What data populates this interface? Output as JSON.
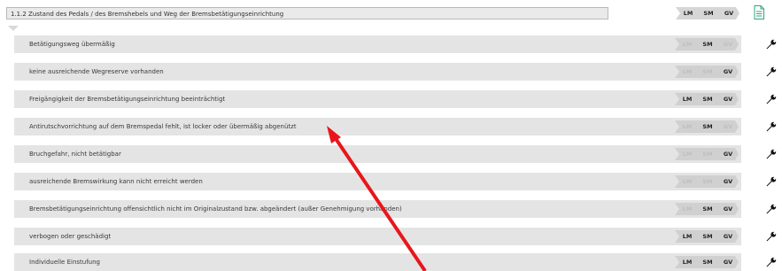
{
  "header": {
    "title": "1.1.2 Zustand des Pedals / des Bremshebels und Weg der Bremsbetätigungseinrichtung",
    "badges": {
      "lm": "LM",
      "sm": "SM",
      "gv": "GV"
    }
  },
  "icons": {
    "document": "document-icon",
    "wrench": "wrench-icon",
    "annotation": "red-arrow"
  },
  "colors": {
    "accent_green": "#2fa57b",
    "arrow_red": "#e8161b",
    "row_bg": "#e4e4e4"
  },
  "rows": [
    {
      "label": "Betätigungsweg übermäßig",
      "lm": "LM",
      "sm": "SM",
      "gv": "GV",
      "lm_on": false,
      "sm_on": true,
      "gv_on": false
    },
    {
      "label": "keine ausreichende Wegreserve vorhanden",
      "lm": "LM",
      "sm": "SM",
      "gv": "GV",
      "lm_on": false,
      "sm_on": false,
      "gv_on": true
    },
    {
      "label": "Freigängigkeit der Bremsbetätigungseinrichtung beeinträchtigt",
      "lm": "LM",
      "sm": "SM",
      "gv": "GV",
      "lm_on": true,
      "sm_on": true,
      "gv_on": true
    },
    {
      "label": "Antirutschvorrichtung auf dem Bremspedal fehlt, ist locker oder übermäßig abgenützt",
      "lm": "LM",
      "sm": "SM",
      "gv": "GV",
      "lm_on": false,
      "sm_on": true,
      "gv_on": false
    },
    {
      "label": "Bruchgefahr, nicht betätigbar",
      "lm": "LM",
      "sm": "SM",
      "gv": "GV",
      "lm_on": false,
      "sm_on": false,
      "gv_on": true
    },
    {
      "label": "ausreichende Bremswirkung kann nicht erreicht werden",
      "lm": "LM",
      "sm": "SM",
      "gv": "GV",
      "lm_on": false,
      "sm_on": false,
      "gv_on": true
    },
    {
      "label": "Bremsbetätigungseinrichtung offensichtlich nicht im Originalzustand bzw. abgeändert (außer Genehmigung vorhanden)",
      "lm": "LM",
      "sm": "SM",
      "gv": "GV",
      "lm_on": false,
      "sm_on": true,
      "gv_on": true
    },
    {
      "label": "verbogen oder geschädigt",
      "lm": "LM",
      "sm": "SM",
      "gv": "GV",
      "lm_on": true,
      "sm_on": true,
      "gv_on": true
    },
    {
      "label": "Individuelle Einstufung",
      "lm": "LM",
      "sm": "SM",
      "gv": "GV",
      "lm_on": true,
      "sm_on": true,
      "gv_on": true
    }
  ]
}
